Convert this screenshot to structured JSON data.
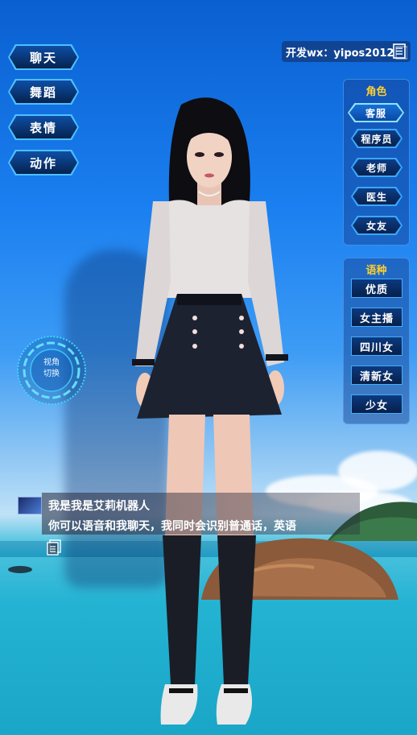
{
  "left_menu": [
    {
      "label": "聊天"
    },
    {
      "label": "舞蹈"
    },
    {
      "label": "表情"
    },
    {
      "label": "动作"
    }
  ],
  "developer": {
    "label": "开发wx：yipos2012",
    "icon": "document-icon"
  },
  "role_panel": {
    "title": "角色",
    "items": [
      {
        "label": "客服",
        "active": true
      },
      {
        "label": "程序员",
        "active": false
      },
      {
        "label": "老师",
        "active": false
      },
      {
        "label": "医生",
        "active": false
      },
      {
        "label": "女友",
        "active": false
      }
    ]
  },
  "voice_panel": {
    "title": "语种",
    "items": [
      {
        "label": "优质"
      },
      {
        "label": "女主播"
      },
      {
        "label": "四川女"
      },
      {
        "label": "清新女"
      },
      {
        "label": "少女"
      }
    ]
  },
  "view_toggle": {
    "line1": "视角",
    "line2": "切换"
  },
  "chat": {
    "line1": "我是我是艾莉机器人",
    "line2": "你可以语音和我聊天，我同时会识别普通话，英语"
  },
  "colors": {
    "accent": "#49b8ff",
    "title": "#ffcf2e",
    "button_bg": "#072a5c"
  }
}
